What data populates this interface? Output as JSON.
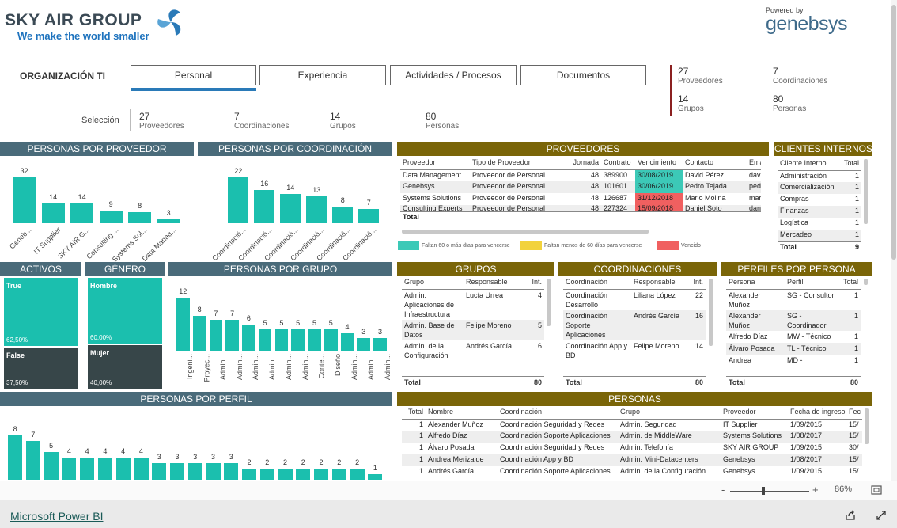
{
  "logo": {
    "brand": "SKY AIR GROUP",
    "tagline": "We make the world smaller"
  },
  "powered": {
    "label": "Powered by",
    "brand": "genebsys"
  },
  "org_title": "ORGANIZACIÓN TI",
  "tabs": [
    "Personal",
    "Experiencia",
    "Actividades / Procesos",
    "Documentos"
  ],
  "top_kpis": [
    {
      "n": "27",
      "l": "Proveedores"
    },
    {
      "n": "7",
      "l": "Coordinaciones"
    },
    {
      "n": "14",
      "l": "Grupos"
    },
    {
      "n": "80",
      "l": "Personas"
    }
  ],
  "seleccion": {
    "label": "Selección",
    "kpis": [
      {
        "n": "27",
        "l": "Proveedores"
      },
      {
        "n": "7",
        "l": "Coordinaciones"
      },
      {
        "n": "14",
        "l": "Grupos"
      },
      {
        "n": "80",
        "l": "Personas"
      }
    ]
  },
  "titles": {
    "por_proveedor": "PERSONAS POR PROVEEDOR",
    "por_coord": "PERSONAS POR COORDINACIÓN",
    "proveedores": "PROVEEDORES",
    "clientes": "CLIENTES INTERNOS",
    "activos": "ACTIVOS",
    "genero": "GÉNERO",
    "por_grupo": "PERSONAS POR GRUPO",
    "grupos": "GRUPOS",
    "coordinaciones": "COORDINACIONES",
    "perfiles": "PERFILES POR PERSONA",
    "por_perfil": "PERSONAS POR PERFIL",
    "personas": "PERSONAS"
  },
  "chart_data": [
    {
      "type": "bar",
      "title": "PERSONAS POR PROVEEDOR",
      "categories": [
        "Geneb...",
        "IT Supplier",
        "SKY AIR G...",
        "Consulting ...",
        "Systems Sol...",
        "Data Manag..."
      ],
      "values": [
        32,
        14,
        14,
        9,
        8,
        3
      ]
    },
    {
      "type": "bar",
      "title": "PERSONAS POR COORDINACIÓN",
      "categories": [
        "Coordinació...",
        "Coordinació...",
        "Coordinació...",
        "Coordinació...",
        "Coordinació...",
        "Coordinació..."
      ],
      "values": [
        22,
        16,
        14,
        13,
        8,
        7
      ]
    },
    {
      "type": "bar",
      "title": "PERSONAS POR GRUPO",
      "categories": [
        "Ingeni...",
        "Proyec...",
        "Admin...",
        "Admin...",
        "Admin...",
        "Admin...",
        "Admin...",
        "Admin...",
        "Conte...",
        "Diseño",
        "Admin...",
        "Admin...",
        "Admin..."
      ],
      "values": [
        12,
        8,
        7,
        7,
        6,
        5,
        5,
        5,
        5,
        5,
        4,
        3,
        3
      ]
    },
    {
      "type": "bar",
      "title": "PERSONAS POR PERFIL",
      "categories": [
        "",
        "",
        "",
        "",
        "",
        "",
        "",
        "",
        "",
        "",
        "",
        "",
        "",
        "",
        "",
        "",
        "",
        "",
        "",
        ""
      ],
      "values": [
        8,
        7,
        5,
        4,
        4,
        4,
        4,
        4,
        3,
        3,
        3,
        3,
        3,
        2,
        2,
        2,
        2,
        2,
        2,
        2,
        1
      ]
    }
  ],
  "proveedores": {
    "headers": [
      "Proveedor",
      "Tipo de Proveedor",
      "Jornada",
      "Contrato",
      "Vencimiento",
      "Contacto",
      "Ema"
    ],
    "rows": [
      [
        "Data Management",
        "Proveedor de Personal",
        "48",
        "389900",
        "30/08/2019",
        "David Pérez",
        "dav"
      ],
      [
        "Genebsys",
        "Proveedor de Personal",
        "48",
        "101601",
        "30/06/2019",
        "Pedro Tejada",
        "ped"
      ],
      [
        "Systems Solutions",
        "Proveedor de Personal",
        "48",
        "126687",
        "31/12/2018",
        "Mario Molina",
        "mar"
      ],
      [
        "Consulting Experts",
        "Proveedor de Personal",
        "48",
        "227324",
        "15/09/2018",
        "Daniel Soto",
        "dan"
      ]
    ],
    "total": "Total",
    "legend": [
      "Faltan 60 o más días para vencerse",
      "Faltan menos de 60 días para vencerse",
      "Vencido"
    ],
    "legend_colors": [
      "#3cc9b7",
      "#f2d23c",
      "#f06060"
    ]
  },
  "clientes": {
    "headers": [
      "Cliente Interno",
      "Total"
    ],
    "rows": [
      [
        "Administración",
        "1"
      ],
      [
        "Comercialización",
        "1"
      ],
      [
        "Compras",
        "1"
      ],
      [
        "Finanzas",
        "1"
      ],
      [
        "Logística",
        "1"
      ],
      [
        "Mercadeo",
        "1"
      ]
    ],
    "total": [
      "Total",
      "9"
    ]
  },
  "activos": {
    "true_label": "True",
    "true_pct": "62,50%",
    "false_label": "False",
    "false_pct": "37,50%",
    "true_share": 0.625
  },
  "genero": {
    "m_label": "Hombre",
    "m_pct": "60,00%",
    "f_label": "Mujer",
    "f_pct": "40,00%",
    "m_share": 0.6
  },
  "grupos": {
    "headers": [
      "Grupo",
      "Responsable",
      "Int."
    ],
    "rows": [
      [
        "Admin. Aplicaciones de Infraestructura",
        "Lucía Urrea",
        "4"
      ],
      [
        "Admin. Base de Datos",
        "Felipe Moreno",
        "5"
      ],
      [
        "Admin. de la Configuración",
        "Andrés García",
        "6"
      ]
    ],
    "total": [
      "Total",
      "80"
    ]
  },
  "coordinaciones": {
    "headers": [
      "Coordinación",
      "Responsable",
      "Int."
    ],
    "rows": [
      [
        "Coordinación Desarrollo",
        "Liliana López",
        "22"
      ],
      [
        "Coordinación Soporte Aplicaciones",
        "Andrés García",
        "16"
      ],
      [
        "Coordinación App y BD",
        "Felipe Moreno",
        "14"
      ]
    ],
    "total": [
      "Total",
      "80"
    ]
  },
  "perfiles": {
    "headers": [
      "Persona",
      "Perfil",
      "Total"
    ],
    "rows": [
      [
        "Alexander Muñoz",
        "SG - Consultor",
        "1"
      ],
      [
        "Alexander Muñoz",
        "SG - Coordinador",
        "1"
      ],
      [
        "Alfredo Díaz",
        "MW - Técnico",
        "1"
      ],
      [
        "Álvaro Posada",
        "TL - Técnico",
        "1"
      ],
      [
        "Andrea",
        "MD -",
        "1"
      ]
    ],
    "total": [
      "Total",
      "80"
    ]
  },
  "personas": {
    "headers": [
      "Total",
      "Nombre",
      "Coordinación",
      "Grupo",
      "Proveedor",
      "Fecha de ingreso",
      "Fec"
    ],
    "rows": [
      [
        "1",
        "Alexander Muñoz",
        "Coordinación Seguridad y Redes",
        "Admin. Seguridad",
        "IT Supplier",
        "1/09/2015",
        "15/"
      ],
      [
        "1",
        "Alfredo Díaz",
        "Coordinación Soporte Aplicaciones",
        "Admin. de MiddleWare",
        "Systems Solutions",
        "1/08/2017",
        "15/"
      ],
      [
        "1",
        "Álvaro Posada",
        "Coordinación Seguridad y Redes",
        "Admin. Telefonía",
        "SKY AIR GROUP",
        "1/09/2015",
        "30/"
      ],
      [
        "1",
        "Andrea Merizalde",
        "Coordinación App y BD",
        "Admin. Mini-Datacenters",
        "Genebsys",
        "1/08/2017",
        "15/"
      ],
      [
        "1",
        "Andrés García",
        "Coordinación Soporte Aplicaciones",
        "Admin. de la Configuración",
        "Genebsys",
        "1/09/2015",
        "15/"
      ]
    ]
  },
  "footer": {
    "link": "Microsoft Power BI",
    "zoom": "86%",
    "minus": "-",
    "plus": "+"
  }
}
